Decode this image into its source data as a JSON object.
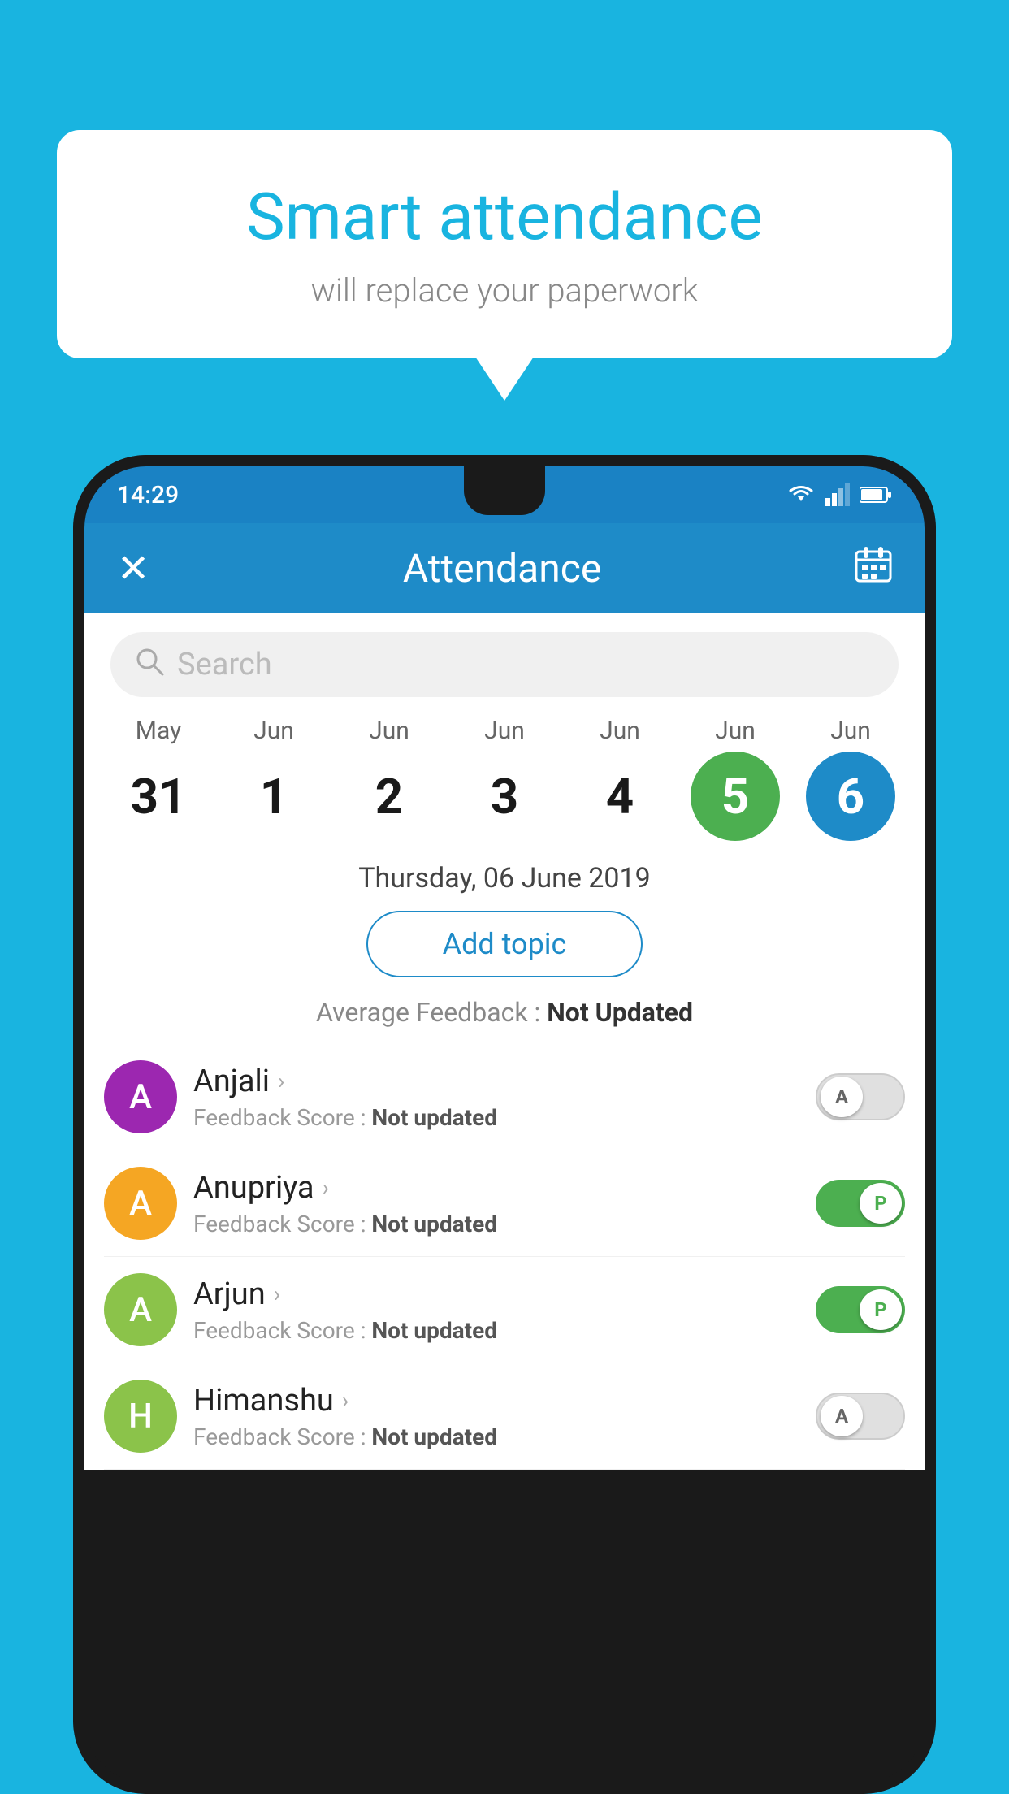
{
  "background_color": "#19b4e0",
  "bubble": {
    "title": "Smart attendance",
    "subtitle": "will replace your paperwork"
  },
  "status_bar": {
    "time": "14:29"
  },
  "header": {
    "title": "Attendance",
    "close_icon": "✕",
    "calendar_icon": "calendar"
  },
  "search": {
    "placeholder": "Search"
  },
  "calendar": {
    "dates": [
      {
        "month": "May",
        "day": "31",
        "state": "normal"
      },
      {
        "month": "Jun",
        "day": "1",
        "state": "normal"
      },
      {
        "month": "Jun",
        "day": "2",
        "state": "normal"
      },
      {
        "month": "Jun",
        "day": "3",
        "state": "normal"
      },
      {
        "month": "Jun",
        "day": "4",
        "state": "normal"
      },
      {
        "month": "Jun",
        "day": "5",
        "state": "today"
      },
      {
        "month": "Jun",
        "day": "6",
        "state": "selected"
      }
    ]
  },
  "selected_date": "Thursday, 06 June 2019",
  "add_topic_label": "Add topic",
  "avg_feedback_label": "Average Feedback : ",
  "avg_feedback_value": "Not Updated",
  "students": [
    {
      "name": "Anjali",
      "avatar_letter": "A",
      "avatar_color": "#9c27b0",
      "feedback": "Feedback Score : ",
      "feedback_value": "Not updated",
      "toggle": "off",
      "toggle_label": "A"
    },
    {
      "name": "Anupriya",
      "avatar_letter": "A",
      "avatar_color": "#f5a623",
      "feedback": "Feedback Score : ",
      "feedback_value": "Not updated",
      "toggle": "on",
      "toggle_label": "P"
    },
    {
      "name": "Arjun",
      "avatar_letter": "A",
      "avatar_color": "#8bc34a",
      "feedback": "Feedback Score : ",
      "feedback_value": "Not updated",
      "toggle": "on",
      "toggle_label": "P"
    },
    {
      "name": "Himanshu",
      "avatar_letter": "H",
      "avatar_color": "#8bc34a",
      "feedback": "Feedback Score : ",
      "feedback_value": "Not updated",
      "toggle": "off",
      "toggle_label": "A"
    }
  ]
}
